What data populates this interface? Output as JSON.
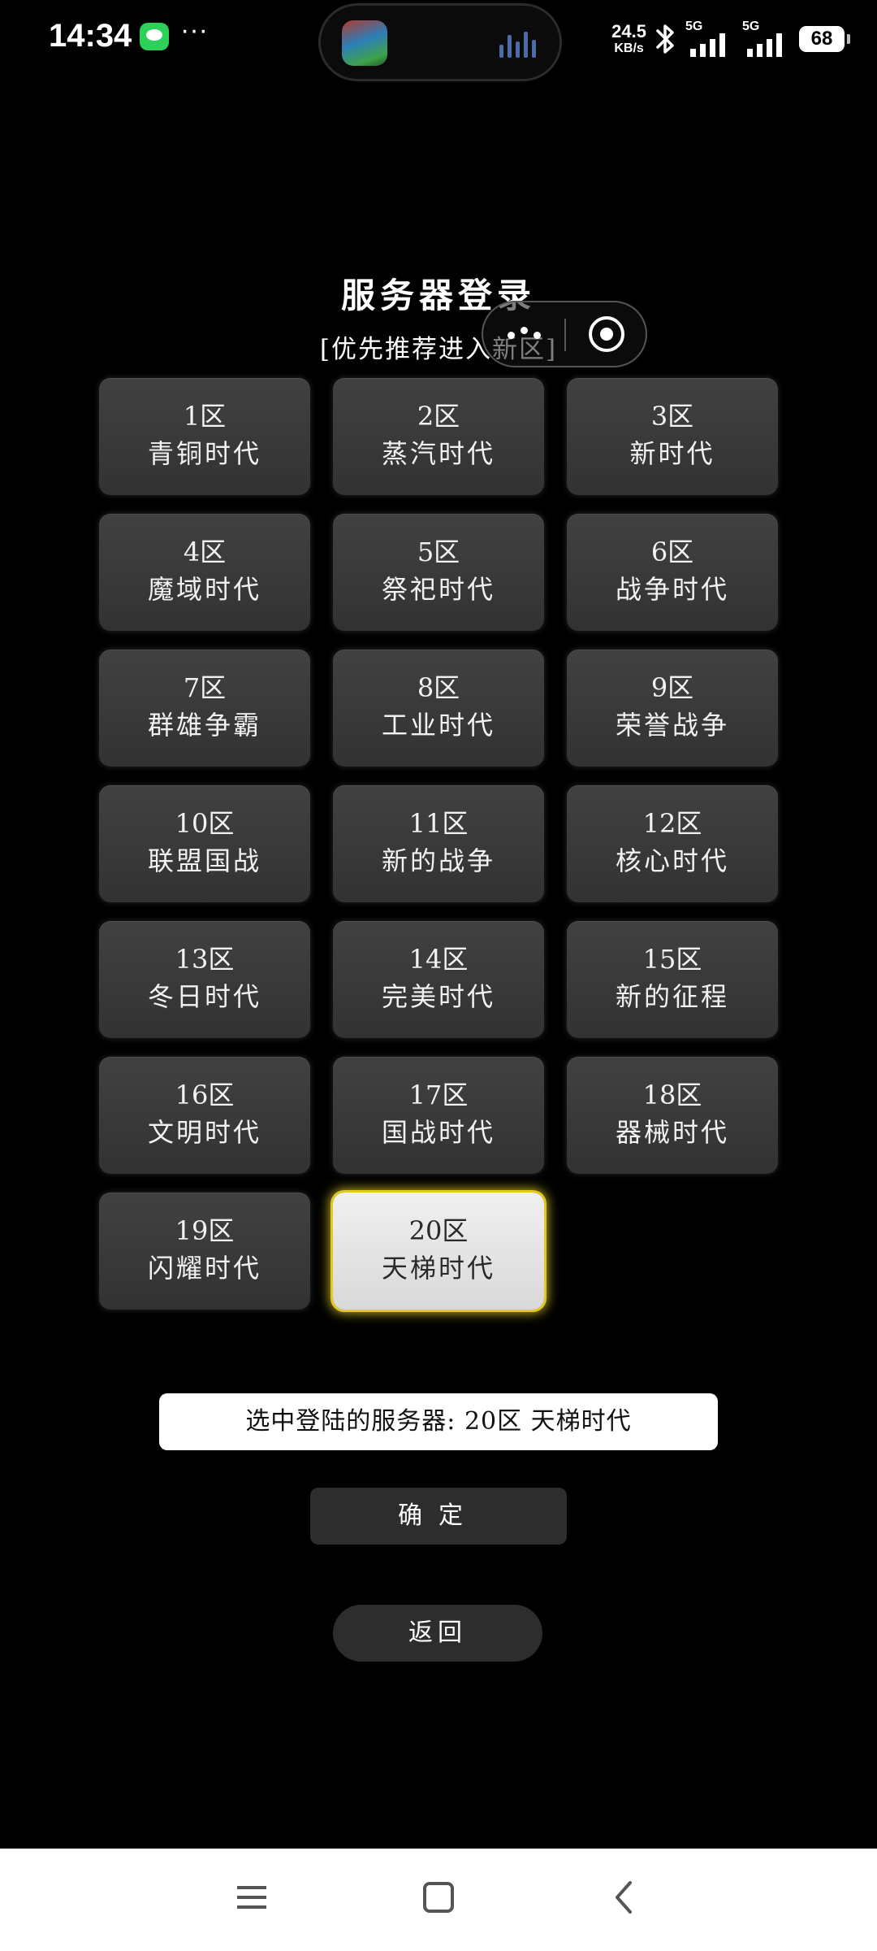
{
  "status_bar": {
    "time": "14:34",
    "more": "···",
    "net_speed_value": "24.5",
    "net_speed_unit": "KB/s",
    "signal_1_label": "5G",
    "signal_2_label": "5G",
    "battery": "68"
  },
  "header": {
    "title": "服务器登录",
    "subtitle": "[优先推荐进入新区]"
  },
  "servers": [
    {
      "zone": "1区",
      "name": "青铜时代"
    },
    {
      "zone": "2区",
      "name": "蒸汽时代"
    },
    {
      "zone": "3区",
      "name": "新时代"
    },
    {
      "zone": "4区",
      "name": "魔域时代"
    },
    {
      "zone": "5区",
      "name": "祭祀时代"
    },
    {
      "zone": "6区",
      "name": "战争时代"
    },
    {
      "zone": "7区",
      "name": "群雄争霸"
    },
    {
      "zone": "8区",
      "name": "工业时代"
    },
    {
      "zone": "9区",
      "name": "荣誉战争"
    },
    {
      "zone": "10区",
      "name": "联盟国战"
    },
    {
      "zone": "11区",
      "name": "新的战争"
    },
    {
      "zone": "12区",
      "name": "核心时代"
    },
    {
      "zone": "13区",
      "name": "冬日时代"
    },
    {
      "zone": "14区",
      "name": "完美时代"
    },
    {
      "zone": "15区",
      "name": "新的征程"
    },
    {
      "zone": "16区",
      "name": "文明时代"
    },
    {
      "zone": "17区",
      "name": "国战时代"
    },
    {
      "zone": "18区",
      "name": "器械时代"
    },
    {
      "zone": "19区",
      "name": "闪耀时代"
    },
    {
      "zone": "20区",
      "name": "天梯时代",
      "selected": true
    }
  ],
  "selection": {
    "text": "选中登陆的服务器: 20区 天梯时代"
  },
  "actions": {
    "confirm_label": "确定",
    "back_label": "返回"
  },
  "colors": {
    "background": "#000000",
    "button": "#383838",
    "selected_button": "#e6e6e6",
    "selected_glow": "#d9c21e",
    "nav_bar": "#ffffff"
  },
  "icons": {
    "message": "message-bubble-icon",
    "bluetooth": "bluetooth-icon",
    "signal": "cellular-signal-icon",
    "battery": "battery-icon",
    "capsule_more": "more-dots-icon",
    "capsule_close": "target-close-icon",
    "nav_menu": "menu-lines-icon",
    "nav_home": "square-home-icon",
    "nav_back": "chevron-left-icon"
  }
}
